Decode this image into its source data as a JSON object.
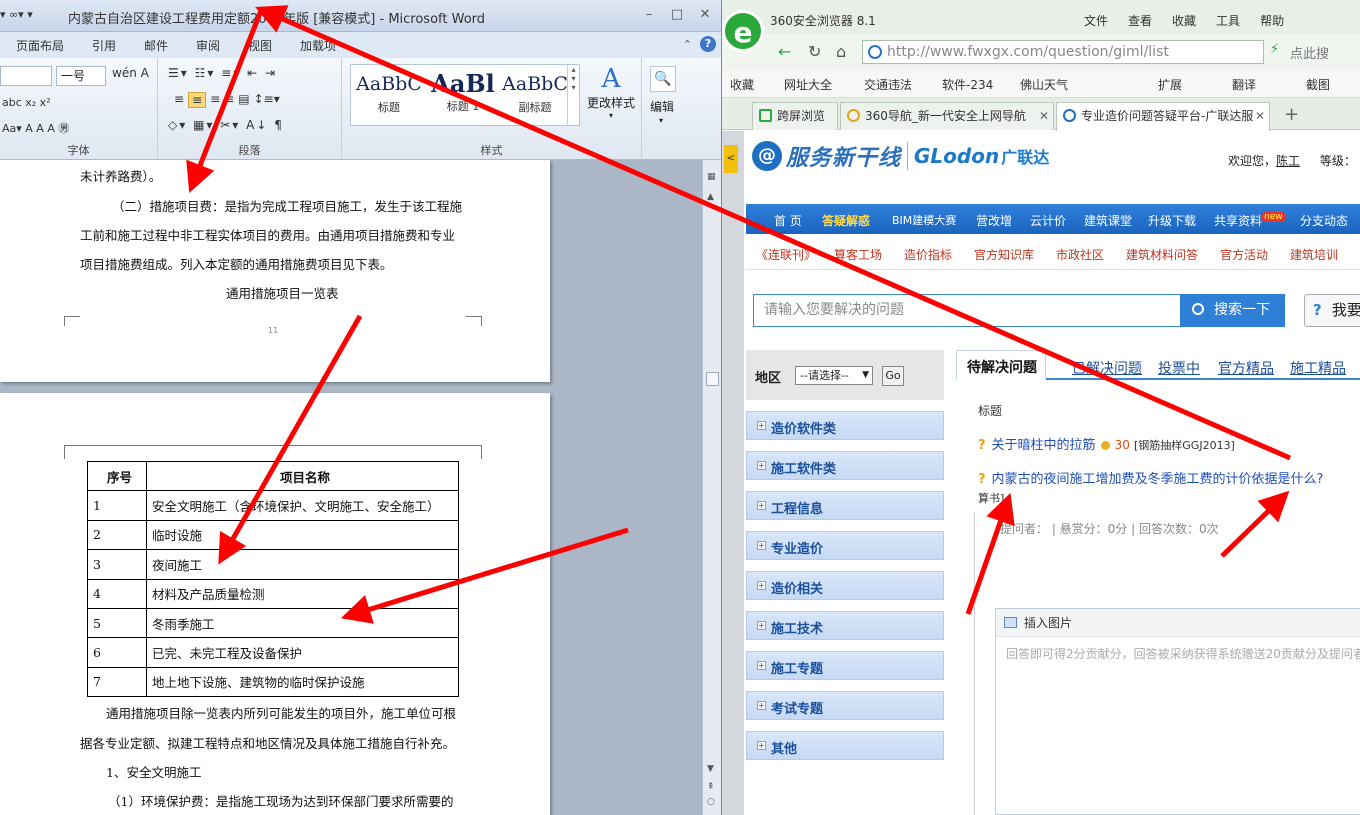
{
  "word": {
    "qat": "▾ ∞▾ ▾",
    "title": "内蒙古自治区建设工程费用定额2009年版 [兼容模式] - Microsoft Word",
    "win_minimize": "–",
    "win_maximize": "□",
    "win_close": "✕",
    "tabs": [
      "页面布局",
      "引用",
      "邮件",
      "审阅",
      "视图",
      "加载项"
    ],
    "help": "?",
    "ribbon": {
      "font_size": "一号",
      "font_group": "字体",
      "paragraph_group": "段落",
      "styles_group": "样式",
      "styles": [
        {
          "sample": "AaBbC",
          "name": "标题"
        },
        {
          "sample": "AaBl",
          "name": "标题 1"
        },
        {
          "sample": "AaBbC",
          "name": "副标题"
        }
      ],
      "change_styles": "更改样式",
      "edit": "编辑",
      "font_btns": "abc  x₂  x²",
      "font_btns2": "Aa▾   A  A   A  ㊚",
      "wen": "wén A"
    },
    "page1_lines": [
      "未计养路费）。",
      "（二）措施项目费：是指为完成工程项目施工，发生于该工程施",
      "工前和施工过程中非工程实体项目的费用。由通用项目措施费和专业",
      "项目措施费组成。列入本定额的通用措施费项目见下表。",
      "通用措施项目一览表"
    ],
    "page1_number": "11",
    "table": {
      "headers": [
        "序号",
        "项目名称"
      ],
      "rows": [
        [
          "1",
          "安全文明施工（含环境保护、文明施工、安全施工）"
        ],
        [
          "2",
          "临时设施"
        ],
        [
          "3",
          "夜间施工"
        ],
        [
          "4",
          "材料及产品质量检测"
        ],
        [
          "5",
          "冬雨季施工"
        ],
        [
          "6",
          "已完、未完工程及设备保护"
        ],
        [
          "7",
          "地上地下设施、建筑物的临时保护设施"
        ]
      ]
    },
    "page2_lines": [
      "通用措施项目除一览表内所列可能发生的项目外，施工单位可根",
      "据各专业定额、拟建工程特点和地区情况及具体施工措施自行补充。",
      "1、安全文明施工",
      "（1）环境保护费：是指施工现场为达到环保部门要求所需要的"
    ]
  },
  "browser": {
    "title": "360安全浏览器 8.1",
    "menu": [
      "文件",
      "查看",
      "收藏",
      "工具",
      "帮助"
    ],
    "url": "http://www.fwxgx.com/question/giml/list",
    "search_placeholder": "点此搜",
    "bookmarks": [
      "收藏",
      "网址大全",
      "交通违法",
      "软件-234",
      "佛山天气",
      "扩展",
      "翻译",
      "截图"
    ],
    "tabs": [
      {
        "label": "跨屏浏览"
      },
      {
        "label": "360导航_新一代安全上网导航"
      },
      {
        "label": "专业造价问题答疑平台-广联达服"
      }
    ],
    "new_tab": "+",
    "side_tab": "<"
  },
  "site": {
    "logo_service": "服务新干线",
    "logo_glodon": "GLodon",
    "logo_cn": "广联达",
    "welcome": "欢迎您，",
    "user": "陈工",
    "level": "等级：",
    "nav": [
      "首 页",
      "答疑解惑",
      "BIM建模大赛",
      "营改增",
      "云计价",
      "建筑课堂",
      "升级下载",
      "共享资料",
      "分支动态"
    ],
    "new_badge": "new",
    "subnav": [
      "《连联刊》",
      "算客工场",
      "造价指标",
      "官方知识库",
      "市政社区",
      "建筑材料问答",
      "官方活动",
      "建筑培训"
    ],
    "search_placeholder": "请输入您要解决的问题",
    "search_button": "搜索一下",
    "ask_button": "我要",
    "region_label": "地区",
    "region_select": "--请选择--",
    "region_go": "Go",
    "categories": [
      "造价软件类",
      "施工软件类",
      "工程信息",
      "专业造价",
      "造价相关",
      "施工技术",
      "施工专题",
      "考试专题",
      "其他"
    ],
    "question_tabs": [
      "待解决问题",
      "已解决问题",
      "投票中",
      "官方精品",
      "施工精品"
    ],
    "col_title": "标题",
    "questions": [
      {
        "title": "关于暗柱中的拉筋",
        "reward": "30",
        "tag": "[钢筋抽样GGJ2013]"
      },
      {
        "title": "内蒙古的夜间施工增加费及冬季施工费的计价依据是什么?",
        "reward": "",
        "tag": ""
      }
    ],
    "q2_wrap": "算书]",
    "meta": "提问者：   |   悬赏分：0分   |   回答次数：0次",
    "editor_insert": "插入图片",
    "editor_placeholder": "回答即可得2分贡献分，回答被采纳获得系统赠送20贡献分及提问者"
  }
}
